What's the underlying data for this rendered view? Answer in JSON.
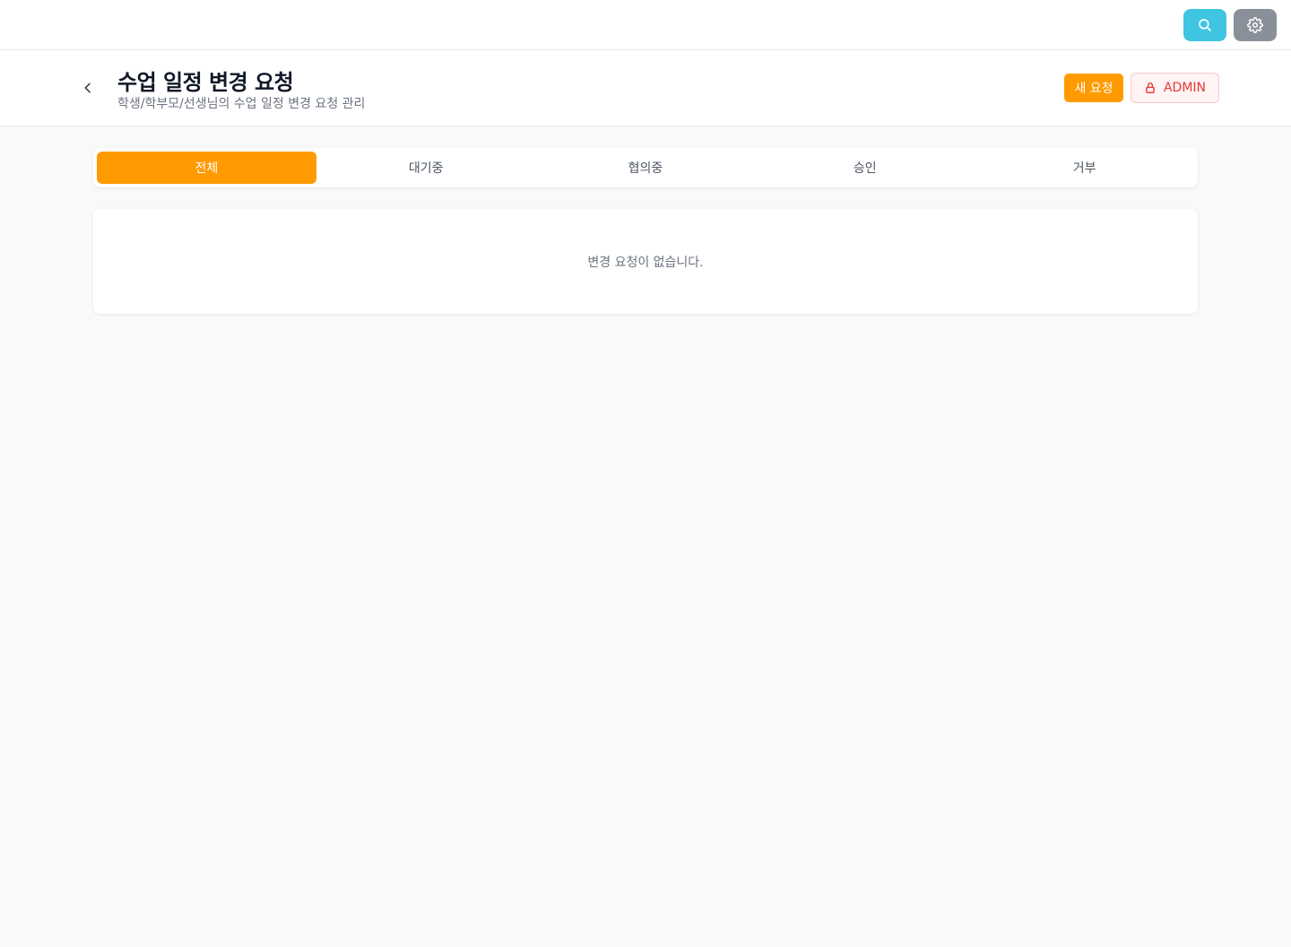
{
  "topbar": {
    "search_icon": "search-icon",
    "settings_icon": "gear-icon",
    "colors": {
      "search": "#3fc5e1",
      "settings": "#8a9099"
    }
  },
  "header": {
    "title": "수업 일정 변경 요청",
    "subtitle": "학생/학부모/선생님의 수업 일정 변경 요청 관리",
    "back_icon": "chevron-left-icon",
    "new_request_label": "새 요청",
    "admin_label": "ADMIN",
    "admin_icon": "lock-icon",
    "colors": {
      "accent": "#ff9a00",
      "admin": "#e53935"
    }
  },
  "tabs": [
    {
      "label": "전체",
      "active": true
    },
    {
      "label": "대기중",
      "active": false
    },
    {
      "label": "협의중",
      "active": false
    },
    {
      "label": "승인",
      "active": false
    },
    {
      "label": "거부",
      "active": false
    }
  ],
  "list": {
    "empty_message": "변경 요청이 없습니다."
  }
}
